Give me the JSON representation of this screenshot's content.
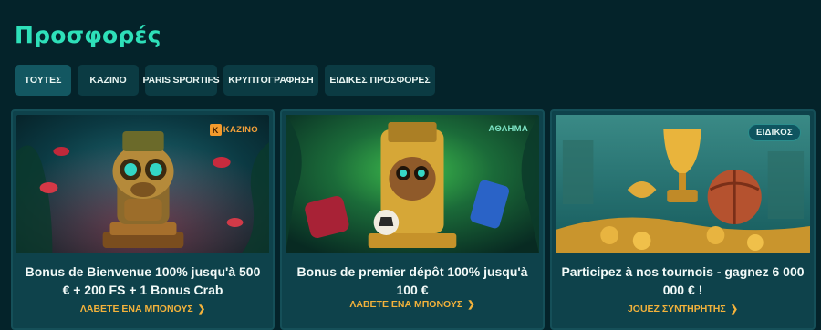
{
  "page": {
    "title": "Προσφορές"
  },
  "tabs": [
    {
      "label": "ΤΟΥΤΕΣ",
      "active": true
    },
    {
      "label": "ΚΑΖΙΝΟ",
      "active": false
    },
    {
      "label": "PARIS SPORTIFS",
      "active": false
    },
    {
      "label": "ΚΡΥΠΤΟΓΡΑΦΗΣΗ",
      "active": false
    },
    {
      "label": "ΕΙΔΙΚΕΣ ΠΡΟΣΦΟΡΕΣ",
      "active": false
    }
  ],
  "cards": [
    {
      "badge": "ΚΑΖΙΝΟ",
      "badge_icon": "casino-k-icon",
      "offer": "Bonus de Bienvenue 100% jusqu'à 500 € + 200 FS + 1 Bonus Crab",
      "cta": "ΛΑΒΕΤΕ ΕΝΑ ΜΠΟΝΟΥΣ",
      "image": "monkey-idol-casino-art"
    },
    {
      "badge": "ΑΘΛΗΜΑ",
      "offer": "Bonus de premier dépôt 100% jusqu'à 100 €",
      "cta": "ΛΑΒΕΤΕ ΕΝΑ ΜΠΟΝΟΥΣ",
      "image": "monkey-idol-football-art"
    },
    {
      "badge": "ΕΙΔΙΚΟΣ",
      "offer": "Participez à nos tournois - gagnez 6 000 000 € !",
      "cta": "JOUEZ ΣΥΝΤΗΡΗΤΗΣ",
      "image": "trophy-coins-art"
    }
  ],
  "icons": {
    "cta_arrow": "chevron-right-icon"
  },
  "colors": {
    "accent_title": "#2ee0b9",
    "cta": "#f3b23b",
    "background": "#04232a",
    "card": "#0e424b"
  }
}
